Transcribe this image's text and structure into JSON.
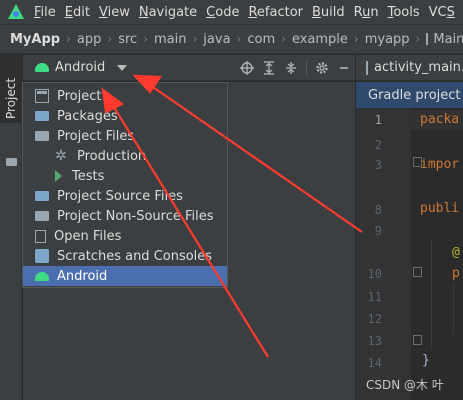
{
  "menubar": {
    "items": [
      "File",
      "Edit",
      "View",
      "Navigate",
      "Code",
      "Refactor",
      "Build",
      "Run",
      "Tools",
      "VCS"
    ],
    "mnemonics": [
      "F",
      "E",
      "V",
      "N",
      "C",
      "R",
      "B",
      "u",
      "T",
      "S"
    ]
  },
  "breadcrumb": {
    "items": [
      "MyApp",
      "app",
      "src",
      "main",
      "java",
      "com",
      "example",
      "myapp",
      "MainActivi"
    ]
  },
  "toolstrip": {
    "tab_label": "Project"
  },
  "project_panel": {
    "view_label": "Android",
    "tools": [
      "locate-icon",
      "expand-all-icon",
      "collapse-all-icon",
      "gear-icon",
      "minimize-icon"
    ]
  },
  "view_dropdown": {
    "options": [
      {
        "label": "Project",
        "icon": "project-icon",
        "sub": false,
        "selected": false
      },
      {
        "label": "Packages",
        "icon": "folder-icon",
        "sub": false,
        "selected": false
      },
      {
        "label": "Project Files",
        "icon": "folder-icon",
        "sub": false,
        "selected": false
      },
      {
        "label": "Production",
        "icon": "gear-icon",
        "sub": true,
        "selected": false
      },
      {
        "label": "Tests",
        "icon": "tests-icon",
        "sub": true,
        "selected": false
      },
      {
        "label": "Project Source Files",
        "icon": "folder-icon",
        "sub": false,
        "selected": false
      },
      {
        "label": "Project Non-Source Files",
        "icon": "folder-icon",
        "sub": false,
        "selected": false
      },
      {
        "label": "Open Files",
        "icon": "file-icon",
        "sub": false,
        "selected": false
      },
      {
        "label": "Scratches and Consoles",
        "icon": "console-icon",
        "sub": false,
        "selected": false
      },
      {
        "label": "Android",
        "icon": "android-icon",
        "sub": false,
        "selected": true
      }
    ]
  },
  "editor": {
    "tab_label": "activity_main.",
    "notice": "Gradle project s",
    "line_numbers": [
      "1",
      "2",
      "3",
      "8",
      "9",
      "10",
      "11",
      "12",
      "13",
      "14"
    ],
    "code_lines": [
      {
        "line": "1",
        "text": "packa"
      },
      {
        "line": "3",
        "text": "impor"
      },
      {
        "line": "8",
        "text": "publi"
      },
      {
        "line": "9",
        "text": "@"
      },
      {
        "line": "10",
        "text": "p"
      },
      {
        "line": "13",
        "text": "}"
      }
    ]
  },
  "watermark": "CSDN @木 叶",
  "colors": {
    "accent": "#4b6eaf",
    "annotation_arrows": "#ff3b30",
    "android_green": "#3ddc84"
  }
}
